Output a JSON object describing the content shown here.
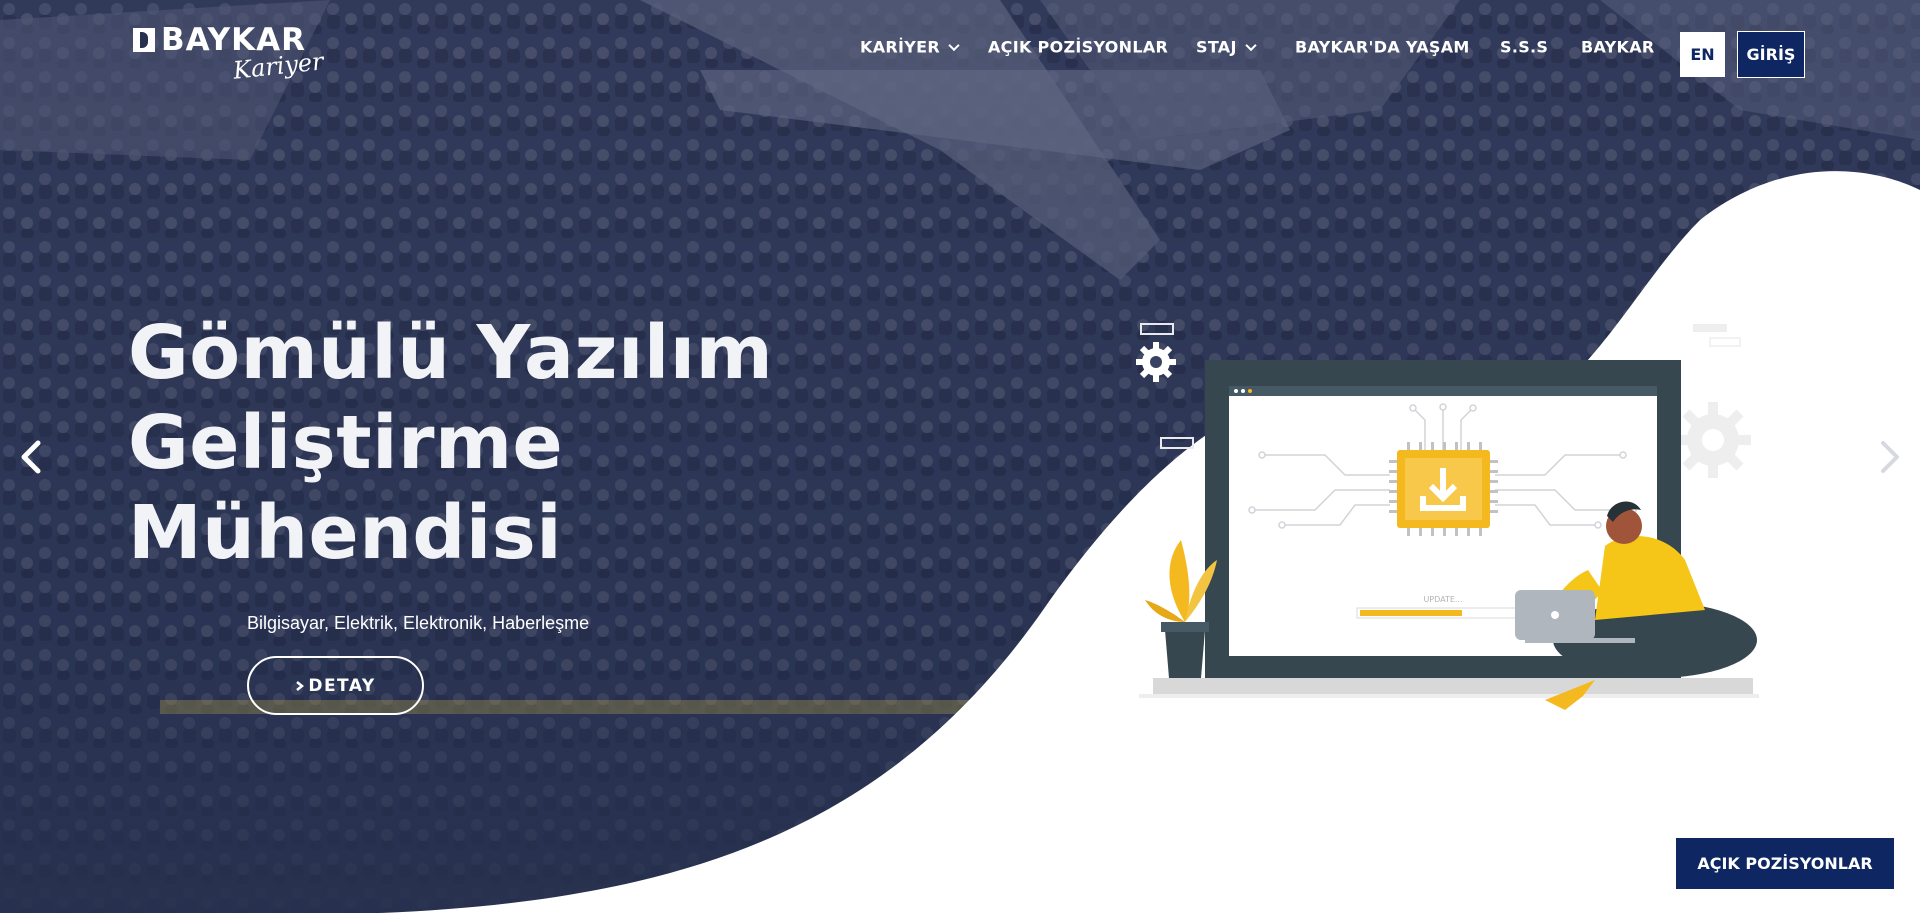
{
  "logo": {
    "brand": "BAYKAR",
    "script": "Kariyer"
  },
  "nav": {
    "items": [
      {
        "label": "KARİYER",
        "dropdown": true
      },
      {
        "label": "AÇIK POZİSYONLAR",
        "dropdown": false
      },
      {
        "label": "STAJ",
        "dropdown": true
      },
      {
        "label": "BAYKAR'DA YAŞAM",
        "dropdown": false
      },
      {
        "label": "S.S.S",
        "dropdown": false
      },
      {
        "label": "BAYKAR",
        "dropdown": false
      }
    ],
    "lang_button": "EN",
    "login_button": "GİRİŞ"
  },
  "slide": {
    "title_lines": [
      "Gömülü Yazılım",
      "Geliştirme",
      "Mühendisi"
    ],
    "subtitle": "Bilgisayar, Elektrik, Elektronik, Haberleşme",
    "detail_button": "DETAY",
    "illustration_text": "UPDATE..."
  },
  "floating_button": "AÇIK POZİSYONLAR",
  "colors": {
    "overlay_navy": "#27314e",
    "brand_navy": "#0e2763",
    "chip_yellow": "#f5b920",
    "white": "#ffffff"
  },
  "icons": {
    "prev": "chevron-left-icon",
    "next": "chevron-right-icon",
    "dropdown": "chevron-down-icon"
  }
}
